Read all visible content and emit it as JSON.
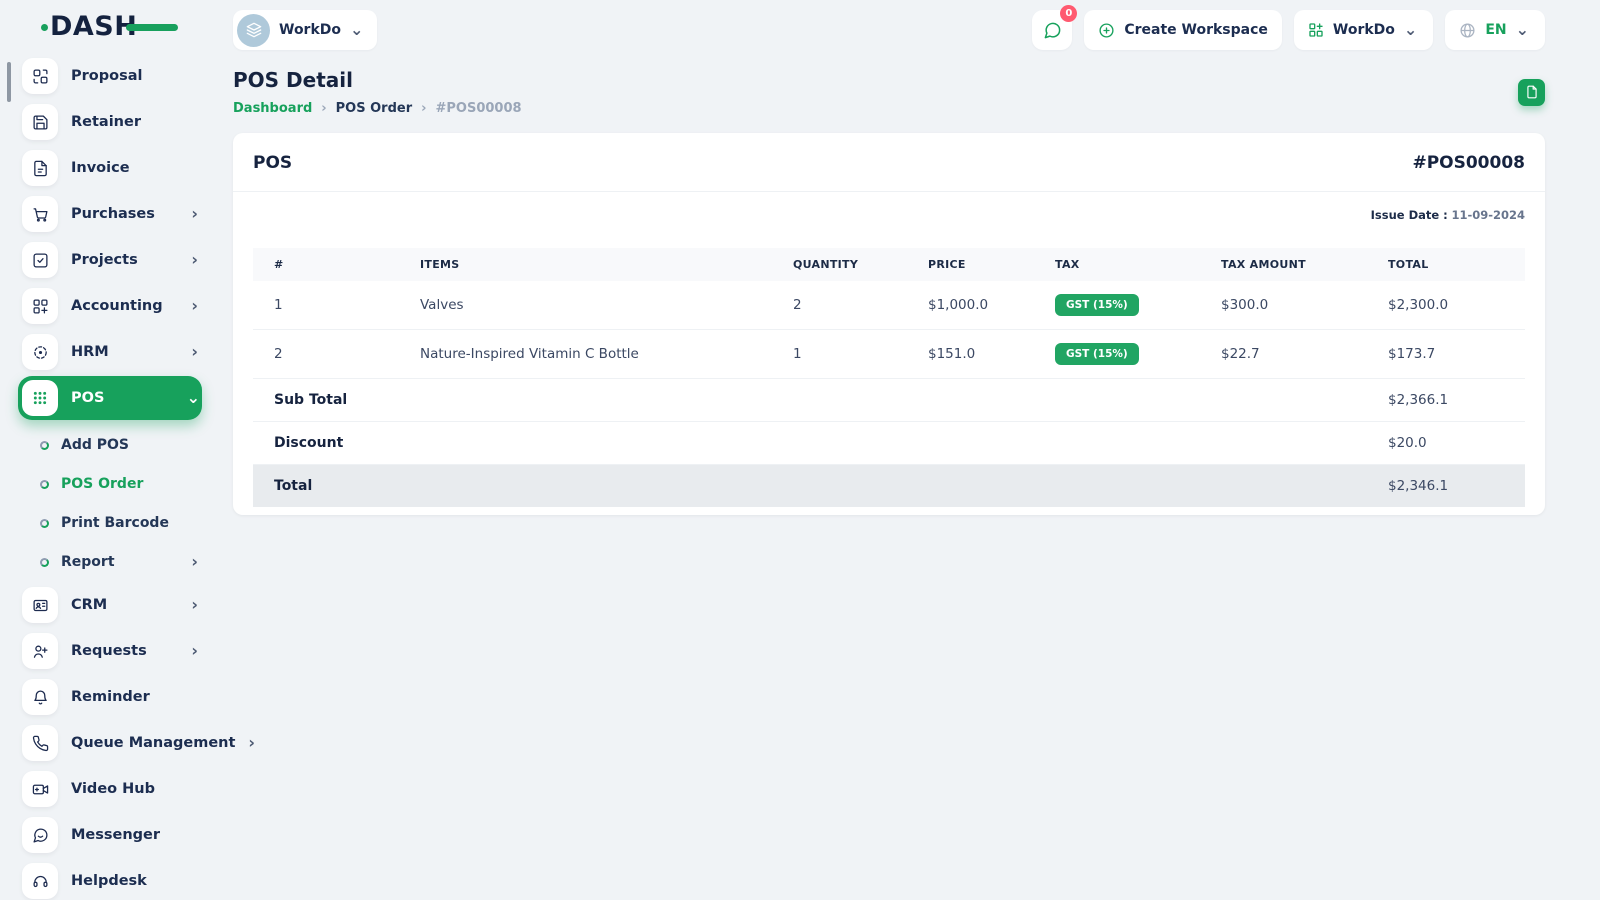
{
  "brand": {
    "logo_text": "DASH",
    "accent_green": "#17a15c",
    "navy": "#16233f",
    "badge_red": "#ff5a70"
  },
  "header": {
    "workspace_selector": {
      "label": "WorkDo"
    },
    "messages_badge": "0",
    "create_workspace_label": "Create Workspace",
    "workspace_menu_label": "WorkDo",
    "language": "EN"
  },
  "sidebar": {
    "items": [
      {
        "label": "Proposal",
        "icon": "proposal-icon"
      },
      {
        "label": "Retainer",
        "icon": "retainer-icon"
      },
      {
        "label": "Invoice",
        "icon": "invoice-icon"
      },
      {
        "label": "Purchases",
        "icon": "purchases-icon",
        "chevron": "›"
      },
      {
        "label": "Projects",
        "icon": "projects-icon",
        "chevron": "›"
      },
      {
        "label": "Accounting",
        "icon": "accounting-icon",
        "chevron": "›"
      },
      {
        "label": "HRM",
        "icon": "hrm-icon",
        "chevron": "›"
      },
      {
        "label": "POS",
        "icon": "pos-icon",
        "active": true,
        "chevron": "⌄"
      },
      {
        "label": "CRM",
        "icon": "crm-icon",
        "chevron": "›"
      },
      {
        "label": "Requests",
        "icon": "requests-icon",
        "chevron": "›"
      },
      {
        "label": "Reminder",
        "icon": "reminder-icon"
      },
      {
        "label": "Queue Management",
        "icon": "queue-icon",
        "chevron": "›"
      },
      {
        "label": "Video Hub",
        "icon": "video-icon"
      },
      {
        "label": "Messenger",
        "icon": "messenger-icon"
      },
      {
        "label": "Helpdesk",
        "icon": "helpdesk-icon"
      }
    ],
    "pos_children": [
      {
        "label": "Add POS"
      },
      {
        "label": "POS Order",
        "active": true
      },
      {
        "label": "Print Barcode"
      },
      {
        "label": "Report",
        "chevron": "›"
      }
    ]
  },
  "page": {
    "title": "POS Detail",
    "breadcrumb": {
      "home": "Dashboard",
      "section": "POS Order",
      "current": "#POS00008"
    }
  },
  "card": {
    "title": "POS",
    "number": "#POS00008",
    "issue_date_label": "Issue Date :",
    "issue_date": "11-09-2024",
    "table": {
      "headers": [
        "#",
        "ITEMS",
        "QUANTITY",
        "PRICE",
        "TAX",
        "TAX AMOUNT",
        "TOTAL"
      ],
      "rows": [
        {
          "num": "1",
          "item": "Valves",
          "qty": "2",
          "price": "$1,000.0",
          "tax": "GST (15%)",
          "tax_amount": "$300.0",
          "total": "$2,300.0"
        },
        {
          "num": "2",
          "item": "Nature-Inspired Vitamin C Bottle",
          "qty": "1",
          "price": "$151.0",
          "tax": "GST (15%)",
          "tax_amount": "$22.7",
          "total": "$173.7"
        }
      ],
      "summary": [
        {
          "label": "Sub Total",
          "value": "$2,366.1"
        },
        {
          "label": "Discount",
          "value": "$20.0"
        },
        {
          "label": "Total",
          "value": "$2,346.1"
        }
      ]
    }
  }
}
